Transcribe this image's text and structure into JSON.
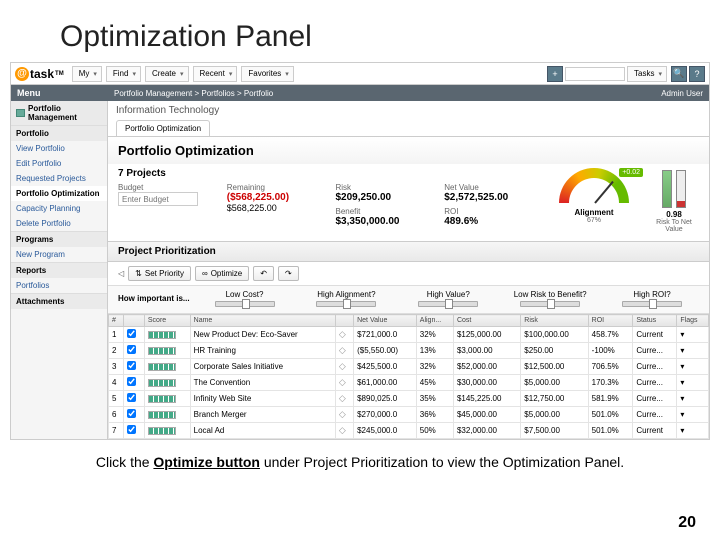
{
  "slide": {
    "title": "Optimization Panel",
    "caption_prefix": "Click the ",
    "caption_bold": "Optimize button",
    "caption_suffix": " under Project Prioritization to view the Optimization Panel.",
    "page": "20"
  },
  "logo": {
    "text": "task",
    "tm": "TM"
  },
  "topnav": [
    "My",
    "Find",
    "Create",
    "Recent",
    "Favorites"
  ],
  "search_context": "Tasks",
  "headerbar": {
    "menu": "Menu",
    "breadcrumb": "Portfolio Management > Portfolios > Portfolio",
    "admin": "Admin User"
  },
  "sidebar": {
    "group1_title": "Portfolio Management",
    "group2_title": "Portfolio",
    "items": [
      "View Portfolio",
      "Edit Portfolio",
      "Requested Projects",
      "Portfolio Optimization",
      "Capacity Planning",
      "Delete Portfolio"
    ],
    "active_index": 3,
    "group3_title": "Programs",
    "group3_items": [
      "New Program"
    ],
    "group4_title": "Reports",
    "group4_items": [
      "Portfolios"
    ],
    "attachments": "Attachments"
  },
  "main": {
    "subtitle": "Information Technology",
    "tab": "Portfolio Optimization",
    "panel_title": "Portfolio Optimization",
    "project_count": "7 Projects",
    "budget_label": "Budget",
    "budget_placeholder": "Enter Budget",
    "remaining_label": "Remaining",
    "remaining_value": "($568,225.00)",
    "remaining_value2": "$568,225.00",
    "risk_label": "Risk",
    "risk_value": "$209,250.00",
    "benefit_label": "Benefit",
    "benefit_value": "$3,350,000.00",
    "netvalue_label": "Net Value",
    "netvalue_value": "$2,572,525.00",
    "roi_label": "ROI",
    "roi_value": "489.6%",
    "gauge_value": "+0.02",
    "gauge_label": "Alignment",
    "gauge_pct": "67%",
    "bars_value": "0.98",
    "bars_label": "Risk To Net Value"
  },
  "prioritization": {
    "section_title": "Project Prioritization",
    "set_priority": "Set Priority",
    "optimize": "Optimize",
    "importance_label": "How important is...",
    "sliders": [
      "Low Cost?",
      "High Alignment?",
      "High Value?",
      "Low Risk to Benefit?",
      "High ROI?"
    ]
  },
  "table": {
    "headers": [
      "#",
      "",
      "Score",
      "Name",
      "",
      "Net Value",
      "Align...",
      "Cost",
      "Risk",
      "ROI",
      "Status",
      "Flags"
    ],
    "rows": [
      {
        "n": "1",
        "name": "New Product Dev: Eco-Saver",
        "nv": "$721,000.0",
        "al": "32%",
        "cost": "$125,000.00",
        "risk": "$100,000.00",
        "roi": "458.7%",
        "st": "Current"
      },
      {
        "n": "2",
        "name": "HR Training",
        "nv": "($5,550.00)",
        "al": "13%",
        "cost": "$3,000.00",
        "risk": "$250.00",
        "roi": "-100%",
        "st": "Curre..."
      },
      {
        "n": "3",
        "name": "Corporate Sales Initiative",
        "nv": "$425,500.0",
        "al": "32%",
        "cost": "$52,000.00",
        "risk": "$12,500.00",
        "roi": "706.5%",
        "st": "Curre..."
      },
      {
        "n": "4",
        "name": "The Convention",
        "nv": "$61,000.00",
        "al": "45%",
        "cost": "$30,000.00",
        "risk": "$5,000.00",
        "roi": "170.3%",
        "st": "Curre..."
      },
      {
        "n": "5",
        "name": "Infinity Web Site",
        "nv": "$890,025.0",
        "al": "35%",
        "cost": "$145,225.00",
        "risk": "$12,750.00",
        "roi": "581.9%",
        "st": "Curre..."
      },
      {
        "n": "6",
        "name": "Branch Merger",
        "nv": "$270,000.0",
        "al": "36%",
        "cost": "$45,000.00",
        "risk": "$5,000.00",
        "roi": "501.0%",
        "st": "Curre..."
      },
      {
        "n": "7",
        "name": "Local Ad",
        "nv": "$245,000.0",
        "al": "50%",
        "cost": "$32,000.00",
        "risk": "$7,500.00",
        "roi": "501.0%",
        "st": "Current"
      }
    ]
  }
}
